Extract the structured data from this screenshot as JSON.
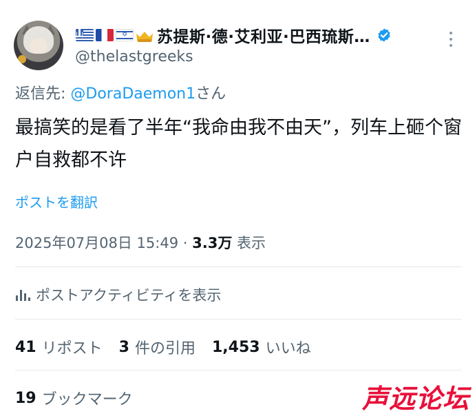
{
  "author": {
    "display_name": "苏提斯·德·艾利亚·巴西琉斯…",
    "handle": "@thelastgreeks",
    "flags": [
      "greece-flag",
      "france-flag",
      "israel-flag",
      "crown"
    ]
  },
  "reply": {
    "prefix": "返信先: ",
    "mention": "@DoraDaemon1",
    "suffix": "さん"
  },
  "tweet": {
    "text": "最搞笑的是看了半年“我命由我不由天”，列车上砸个窗户自救都不许",
    "translate_label": "ポストを翻訳"
  },
  "meta": {
    "timestamp": "2025年07月08日 15:49",
    "separator": " · ",
    "views_count": "3.3万",
    "views_label": " 表示"
  },
  "activity": {
    "label": "ポストアクティビティを表示"
  },
  "stats": {
    "reposts_count": "41",
    "reposts_label": "リポスト",
    "quotes_count": "3",
    "quotes_label": "件の引用",
    "likes_count": "1,453",
    "likes_label": "いいね",
    "bookmarks_count": "19",
    "bookmarks_label": "ブックマーク"
  },
  "watermark": "声远论坛",
  "colors": {
    "accent": "#1d9bf0",
    "secondary_text": "#536471",
    "primary_text": "#0f1419",
    "divider": "#e3e7ea",
    "watermark": "#e8103a"
  }
}
